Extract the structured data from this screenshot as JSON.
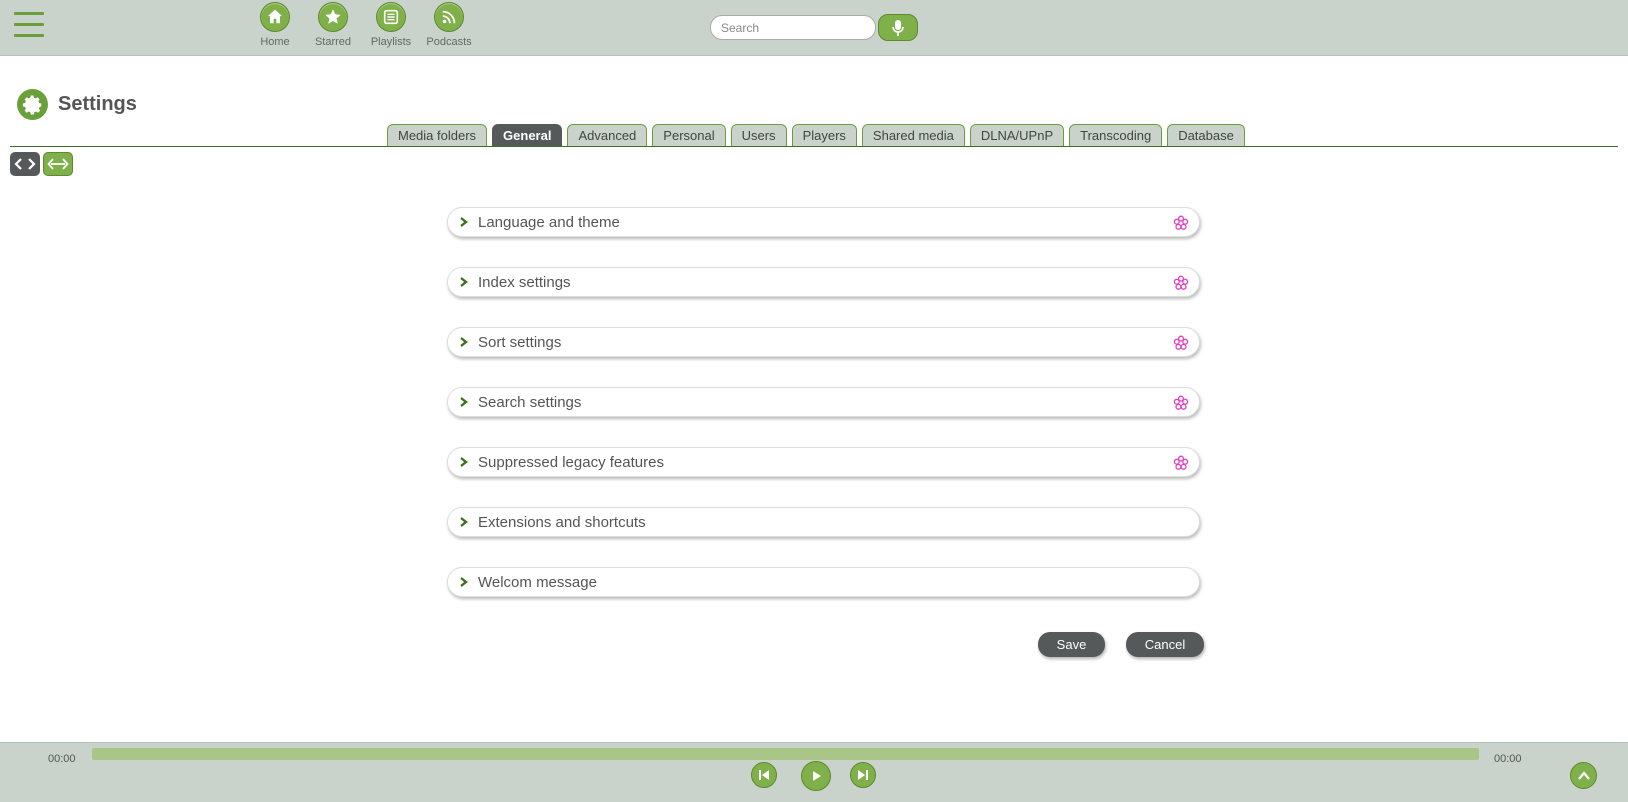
{
  "header": {
    "nav": [
      {
        "label": "Home",
        "icon": "home-icon"
      },
      {
        "label": "Starred",
        "icon": "star-icon"
      },
      {
        "label": "Playlists",
        "icon": "playlist-icon"
      },
      {
        "label": "Podcasts",
        "icon": "rss-icon"
      }
    ],
    "search": {
      "placeholder": "Search",
      "value": ""
    }
  },
  "page": {
    "title": "Settings"
  },
  "tabs": [
    {
      "label": "Media folders",
      "active": false
    },
    {
      "label": "General",
      "active": true
    },
    {
      "label": "Advanced",
      "active": false
    },
    {
      "label": "Personal",
      "active": false
    },
    {
      "label": "Users",
      "active": false
    },
    {
      "label": "Players",
      "active": false
    },
    {
      "label": "Shared media",
      "active": false
    },
    {
      "label": "DLNA/UPnP",
      "active": false
    },
    {
      "label": "Transcoding",
      "active": false
    },
    {
      "label": "Database",
      "active": false
    }
  ],
  "sections": [
    {
      "label": "Language and theme",
      "flagged": true
    },
    {
      "label": "Index settings",
      "flagged": true
    },
    {
      "label": "Sort settings",
      "flagged": true
    },
    {
      "label": "Search settings",
      "flagged": true
    },
    {
      "label": "Suppressed legacy features",
      "flagged": true
    },
    {
      "label": "Extensions and shortcuts",
      "flagged": false
    },
    {
      "label": "Welcom message",
      "flagged": false
    }
  ],
  "actions": {
    "save": "Save",
    "cancel": "Cancel"
  },
  "player": {
    "time_elapsed": "00:00",
    "time_total": "00:00"
  },
  "colors": {
    "accent": "#7fb04a",
    "header_bg": "#c9d3cb",
    "dark": "#55595a",
    "flag": "#e040c0"
  }
}
